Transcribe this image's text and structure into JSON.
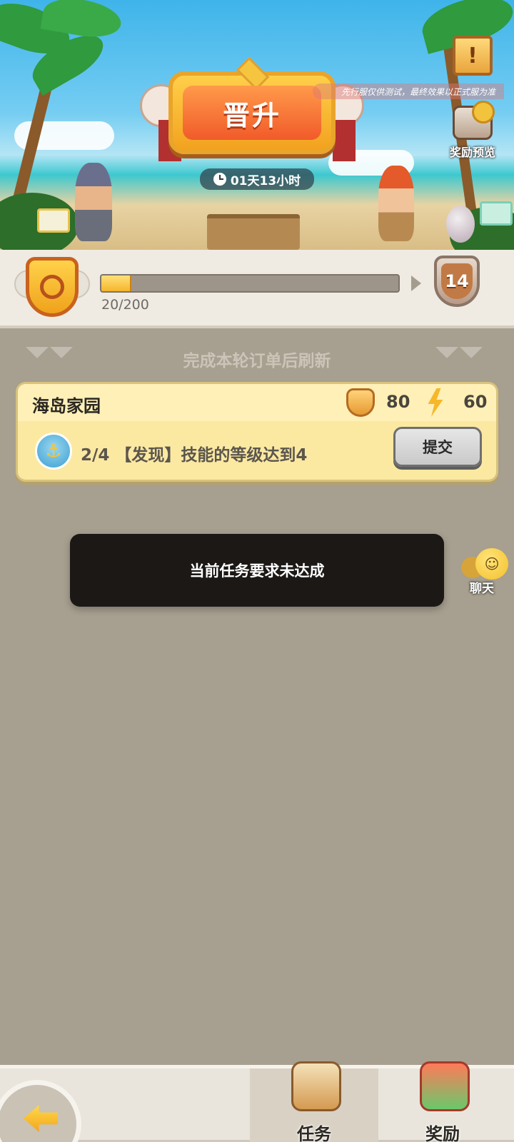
{
  "banner": {
    "title": "晋升",
    "timer": "01天13小时",
    "test_note": "先行服仅供测试，最终效果以正式服为准",
    "reward_preview_label": "奖励预览",
    "scroll_button_glyph": "!"
  },
  "progress": {
    "current": 20,
    "total": 200,
    "text": "20/200",
    "fraction": 0.1,
    "next_level": "14"
  },
  "main": {
    "refresh_text": "完成本轮订单后刷新",
    "order_card": {
      "title": "海岛家园",
      "coin_reward": "80",
      "energy_reward": "60",
      "task_progress": "2/4",
      "task_desc": "【发现】技能的等级达到4",
      "task_text": "2/4 【发现】技能的等级达到4",
      "submit_label": "提交"
    },
    "toast": "当前任务要求未达成",
    "chat_label": "聊天"
  },
  "bottom_nav": {
    "tabs": [
      {
        "label": "任务",
        "active": true
      },
      {
        "label": "奖励",
        "active": false
      }
    ]
  },
  "colors": {
    "background": "#a79f8f",
    "card": "#fbe9a2",
    "accent": "#f5b52a",
    "toast": "#1b1816"
  },
  "icons": {
    "timer": "clock-icon",
    "rank": "rank-badge-icon",
    "coin": "coin-icon",
    "energy": "lightning-icon",
    "task": "anchor-icon",
    "chat": "chat-icon",
    "back": "back-arrow-icon",
    "tasks_tab": "task-scroll-icon",
    "rewards_tab": "gift-icon"
  }
}
